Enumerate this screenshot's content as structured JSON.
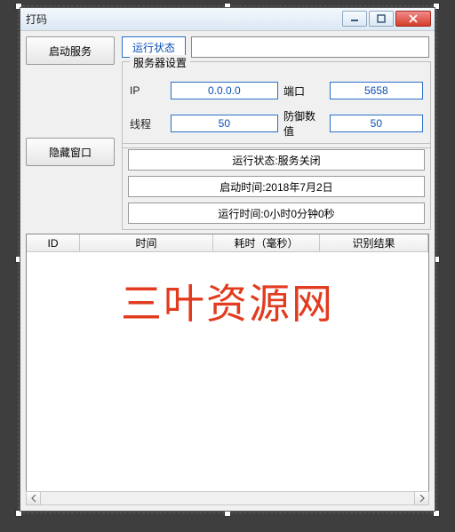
{
  "window": {
    "title": "打码"
  },
  "buttons": {
    "start_service": "启动服务",
    "hide_window": "隐藏窗口",
    "run_status": "运行状态"
  },
  "server_settings": {
    "group_title": "服务器设置",
    "ip_label": "IP",
    "ip_value": "0.0.0.0",
    "port_label": "端口",
    "port_value": "5658",
    "threads_label": "线程",
    "threads_value": "50",
    "defense_label": "防御数值",
    "defense_value": "50"
  },
  "status_lines": {
    "line1": "运行状态:服务关闭",
    "line2": "启动时间:2018年7月2日",
    "line3": "运行时间:0小时0分钟0秒"
  },
  "table": {
    "columns": [
      "ID",
      "时间",
      "耗时（毫秒）",
      "识别结果"
    ]
  },
  "watermark": "三叶资源网"
}
